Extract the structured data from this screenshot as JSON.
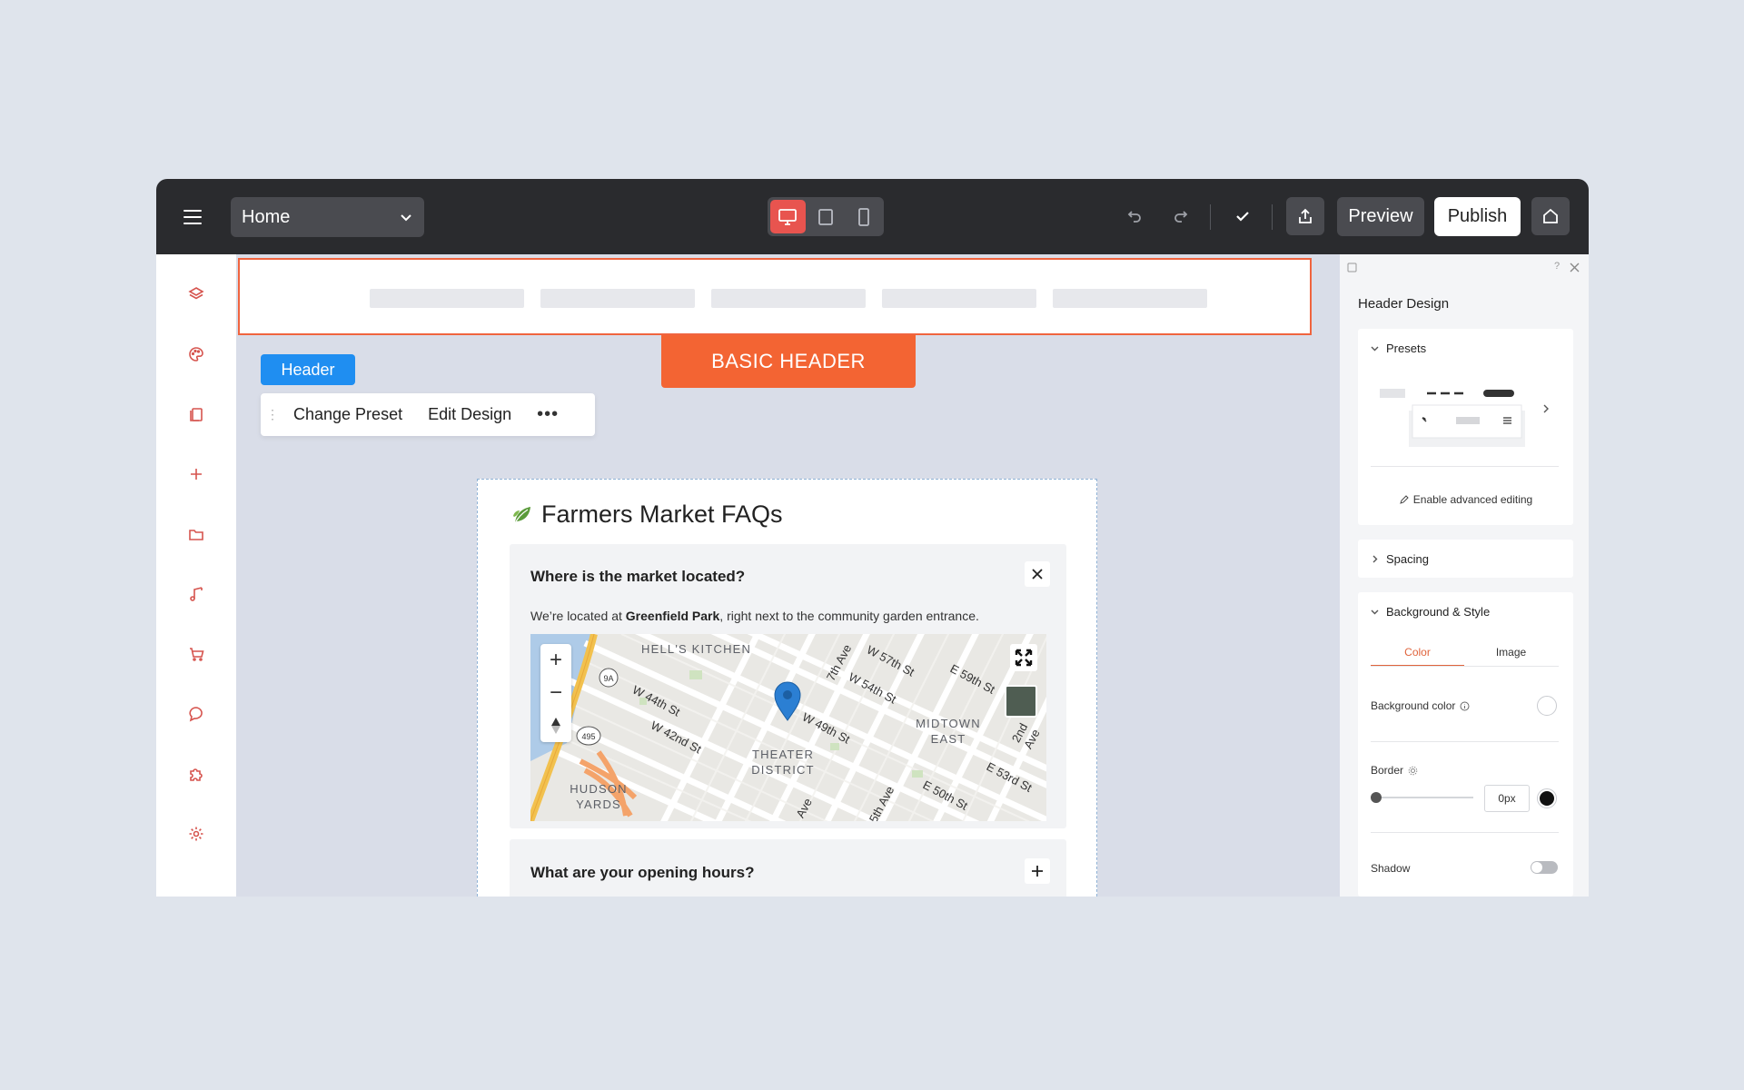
{
  "topbar": {
    "page_select_value": "Home",
    "preview_label": "Preview",
    "publish_label": "Publish"
  },
  "canvas": {
    "section_badge": "BASIC HEADER",
    "element_tag": "Header",
    "context_toolbar": {
      "change_preset_label": "Change Preset",
      "edit_design_label": "Edit Design",
      "more_label": "•••"
    }
  },
  "faq": {
    "title": "Farmers Market FAQs",
    "items": [
      {
        "question": "Where is the market located?",
        "answer_prefix": "We’re located at ",
        "answer_bold": "Greenfield Park",
        "answer_suffix": ", right next to the community garden entrance.",
        "expanded": true
      },
      {
        "question": "What are your opening hours?",
        "expanded": false
      }
    ],
    "map": {
      "areas": [
        "HELL'S KITCHEN",
        "MIDTOWN EAST",
        "THEATER DISTRICT",
        "HUDSON YARDS"
      ],
      "streets": [
        "W 57th St",
        "W 54th St",
        "E 59th St",
        "W 44th St",
        "W 42nd St",
        "W 49th St",
        "E 53rd St",
        "E 50th St",
        "7th Ave",
        "2nd Ave",
        "5th Ave",
        "Ave"
      ],
      "route_badges": [
        "9A",
        "495"
      ],
      "zoom_in": "+",
      "zoom_out": "−"
    }
  },
  "panel": {
    "title": "Header Design",
    "presets_label": "Presets",
    "enable_advanced_label": "Enable advanced editing",
    "spacing_label": "Spacing",
    "bg_style_label": "Background & Style",
    "tab_color": "Color",
    "tab_image": "Image",
    "background_color_label": "Background color",
    "border_label": "Border",
    "border_value": "0px",
    "shadow_label": "Shadow",
    "help_icon": "?",
    "shadow_enabled": false
  },
  "colors": {
    "accent": "#f36433",
    "active_device": "#e8544f",
    "tag_blue": "#1f8ef1",
    "panel_active_tab": "#e0643c",
    "rail_icons": "#d6544e"
  }
}
